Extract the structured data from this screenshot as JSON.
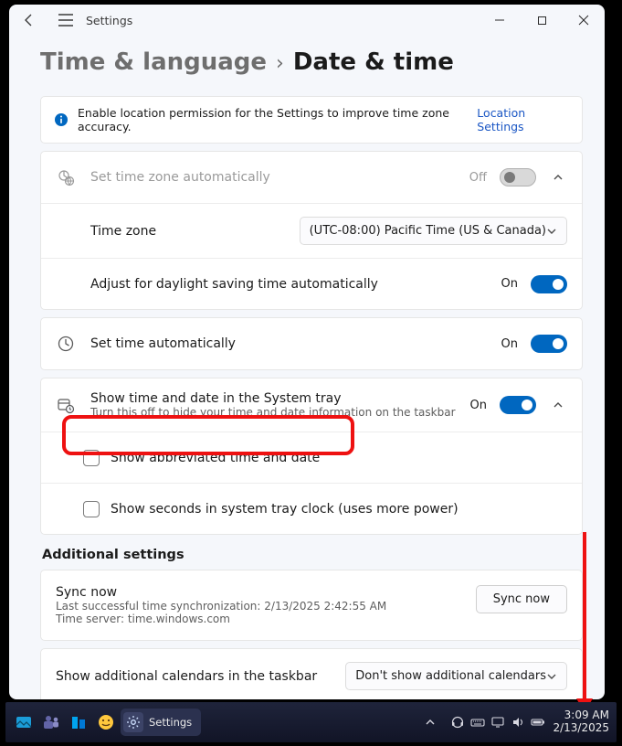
{
  "titlebar": {
    "app_title": "Settings"
  },
  "breadcrumb": {
    "group": "Time & language",
    "page": "Date & time",
    "sep": "›"
  },
  "banner": {
    "text": "Enable location permission for the Settings to improve time zone accuracy.",
    "link": "Location Settings"
  },
  "tz_group": {
    "auto_label": "Set time zone automatically",
    "auto_state": "Off",
    "tz_label": "Time zone",
    "tz_value": "(UTC-08:00) Pacific Time (US & Canada)",
    "dst_label": "Adjust for daylight saving time automatically",
    "dst_state": "On"
  },
  "time_group": {
    "auto_label": "Set time automatically",
    "auto_state": "On"
  },
  "tray_group": {
    "label": "Show time and date in the System tray",
    "sub": "Turn this off to hide your time and date information on the taskbar",
    "state": "On",
    "abbrev_label": "Show abbreviated time and date",
    "seconds_label": "Show seconds in system tray clock (uses more power)"
  },
  "additional": {
    "header": "Additional settings",
    "sync_title": "Sync now",
    "sync_line1": "Last successful time synchronization: 2/13/2025 2:42:55 AM",
    "sync_line2": "Time server: time.windows.com",
    "sync_btn": "Sync now",
    "calendars_label": "Show additional calendars in the taskbar",
    "calendars_value": "Don't show additional calendars"
  },
  "taskbar": {
    "active_app": "Settings",
    "time": "3:09 AM",
    "date": "2/13/2025"
  }
}
